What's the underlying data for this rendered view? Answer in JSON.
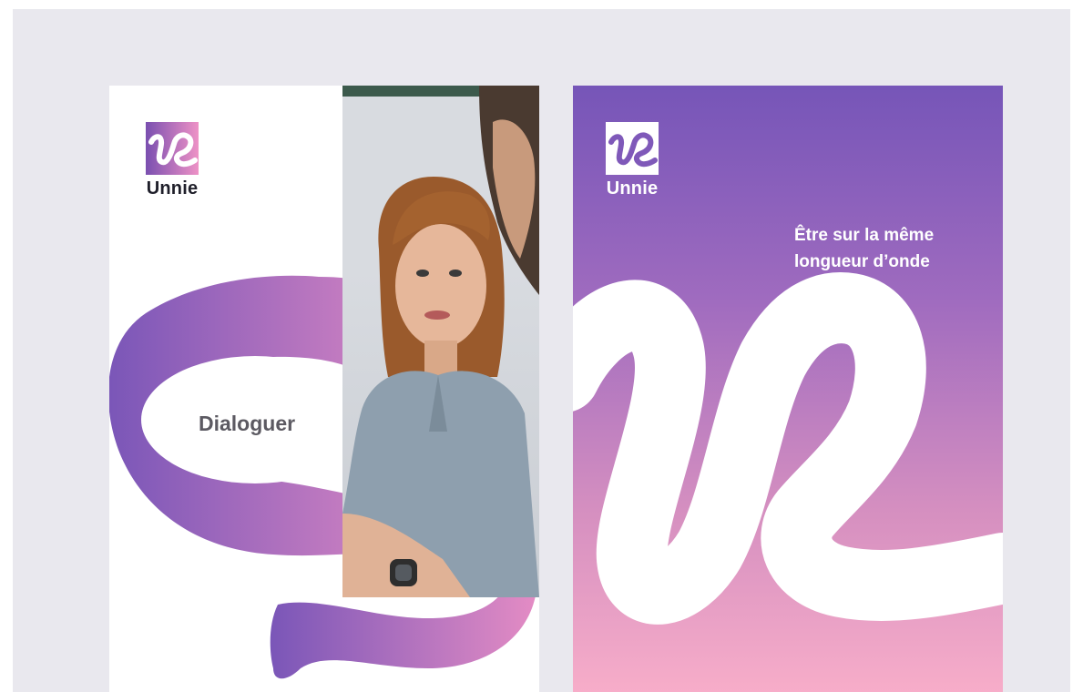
{
  "brand": {
    "name": "Unnie",
    "gradient_start": "#7655b8",
    "gradient_end": "#f7adc9"
  },
  "card_left": {
    "logo_icon": "unnie-logo-icon",
    "label": "Dialoguer",
    "photo_icon": "woman-speaking-photo"
  },
  "card_right": {
    "logo_icon": "unnie-logo-icon",
    "tagline_line1": "Être sur la même",
    "tagline_line2": "longueur d’onde"
  }
}
